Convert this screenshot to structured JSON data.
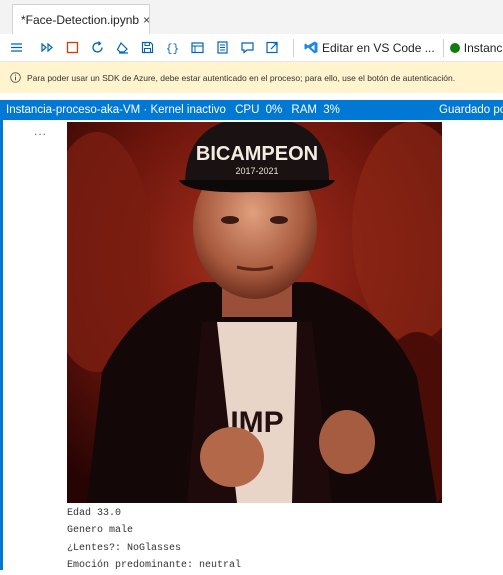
{
  "tab": {
    "title": "*Face-Detection.ipynb",
    "close": "×"
  },
  "toolbar": {
    "icons": [
      "menu-icon",
      "run-all-icon",
      "stop-icon",
      "restart-icon",
      "clear-icon",
      "save-icon",
      "variables-icon",
      "outline-icon",
      "notebook-icon",
      "comment-icon",
      "export-icon"
    ],
    "vscode_label": "Editar en VS Code ...",
    "instance_label": "Instancia",
    "instance_status_color": "#107c10"
  },
  "warning": {
    "text": "Para poder usar un SDK de Azure, debe estar autenticado en el proceso; para ello, use el botón de autenticación."
  },
  "status": {
    "compute": "Instancia-proceso-aka-VM",
    "kernel": "Kernel inactivo",
    "cpu_label": "CPU",
    "cpu_value": "0%",
    "ram_label": "RAM",
    "ram_value": "3%",
    "saved": "Guardado por"
  },
  "cell": {
    "more": "...",
    "image_cap_text": "BICAMPEON",
    "image_cap_years": "2017-2021",
    "image_shirt_text": "IMP"
  },
  "output": {
    "lines": [
      "Edad 33.0",
      "Genero male",
      "¿Lentes?: NoGlasses",
      "Emoción predominante: neutral"
    ]
  },
  "colors": {
    "accent": "#0078d4",
    "warning_bg": "#fff4ce"
  }
}
